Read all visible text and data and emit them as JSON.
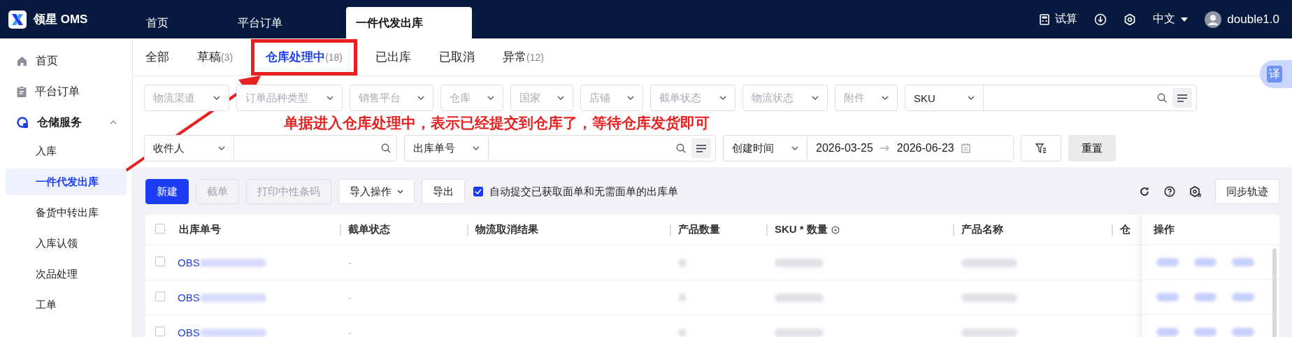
{
  "brand": {
    "name": "领星 OMS"
  },
  "top_tabs": [
    {
      "label": "首页",
      "selected": false
    },
    {
      "label": "平台订单",
      "selected": false
    },
    {
      "label": "一件代发出库",
      "selected": true
    }
  ],
  "top_actions": {
    "trial": "试算",
    "language": "中文",
    "user": "double1.0"
  },
  "sidebar": {
    "items": [
      {
        "label": "首页",
        "selected": false
      },
      {
        "label": "平台订单",
        "selected": false
      },
      {
        "label": "仓储服务",
        "selected": false,
        "expanded": true,
        "children": [
          {
            "label": "入库",
            "selected": false
          },
          {
            "label": "一件代发出库",
            "selected": true
          },
          {
            "label": "备货中转出库",
            "selected": false
          },
          {
            "label": "入库认领",
            "selected": false
          },
          {
            "label": "次品处理",
            "selected": false
          },
          {
            "label": "工单",
            "selected": false
          }
        ]
      }
    ]
  },
  "status_tabs": [
    {
      "label": "全部",
      "selected": false,
      "highlighted": false
    },
    {
      "label": "草稿",
      "count": "(3)",
      "selected": false,
      "highlighted": false
    },
    {
      "label": "仓库处理中",
      "count": "(18)",
      "selected": true,
      "highlighted": true
    },
    {
      "label": "已出库",
      "selected": false,
      "highlighted": false
    },
    {
      "label": "已取消",
      "selected": false,
      "highlighted": false
    },
    {
      "label": "异常",
      "count": "(12)",
      "selected": false,
      "highlighted": false
    }
  ],
  "translate_button": "译",
  "filters": {
    "row_1": [
      {
        "kind": "select",
        "placeholder": "物流渠道"
      },
      {
        "kind": "select",
        "placeholder": "订单品种类型"
      },
      {
        "kind": "select",
        "placeholder": "销售平台"
      },
      {
        "kind": "select",
        "placeholder": "仓库"
      },
      {
        "kind": "select",
        "placeholder": "国家"
      },
      {
        "kind": "select",
        "placeholder": "店铺"
      },
      {
        "kind": "select",
        "placeholder": "截单状态"
      },
      {
        "kind": "select",
        "placeholder": "物流状态"
      },
      {
        "kind": "select",
        "placeholder": "附件"
      },
      {
        "kind": "multi-search",
        "value": "SKU"
      }
    ],
    "row_2": [
      {
        "kind": "search",
        "value": "收件人"
      },
      {
        "kind": "multi-search",
        "value": "出库单号"
      },
      {
        "kind": "date",
        "value": "创建时间",
        "start": "2026-03-25",
        "end": "2026-06-23"
      }
    ],
    "reset": "重置"
  },
  "annotation": {
    "text": "单据进入仓库处理中，表示已经提交到仓库了，等待仓库发货即可"
  },
  "toolbar": {
    "buttons": [
      {
        "label": "新建",
        "kind": "primary",
        "disabled": false
      },
      {
        "label": "截单",
        "kind": "plain",
        "disabled": true
      },
      {
        "label": "打印中性条码",
        "kind": "plain",
        "disabled": true
      },
      {
        "label": "导入操作",
        "kind": "dropdown",
        "disabled": false
      },
      {
        "label": "导出",
        "kind": "plain",
        "disabled": false
      }
    ],
    "auto_submit": {
      "label": "自动提交已获取面单和无需面单的出库单",
      "checked": true
    },
    "sync": "同步轨迹"
  },
  "table": {
    "all_selected": false,
    "columns": [
      "出库单号",
      "截单状态",
      "物流取消结果",
      "产品数量",
      "SKU * 数量",
      "产品名称",
      "仓"
    ],
    "actions_column": "操作",
    "rows": [
      {
        "order_prefix": "OBS",
        "cutoff": "-",
        "selected": false
      },
      {
        "order_prefix": "OBS",
        "cutoff": "-",
        "selected": false
      },
      {
        "order_prefix": "OBS",
        "cutoff": "-",
        "selected": false
      }
    ]
  }
}
